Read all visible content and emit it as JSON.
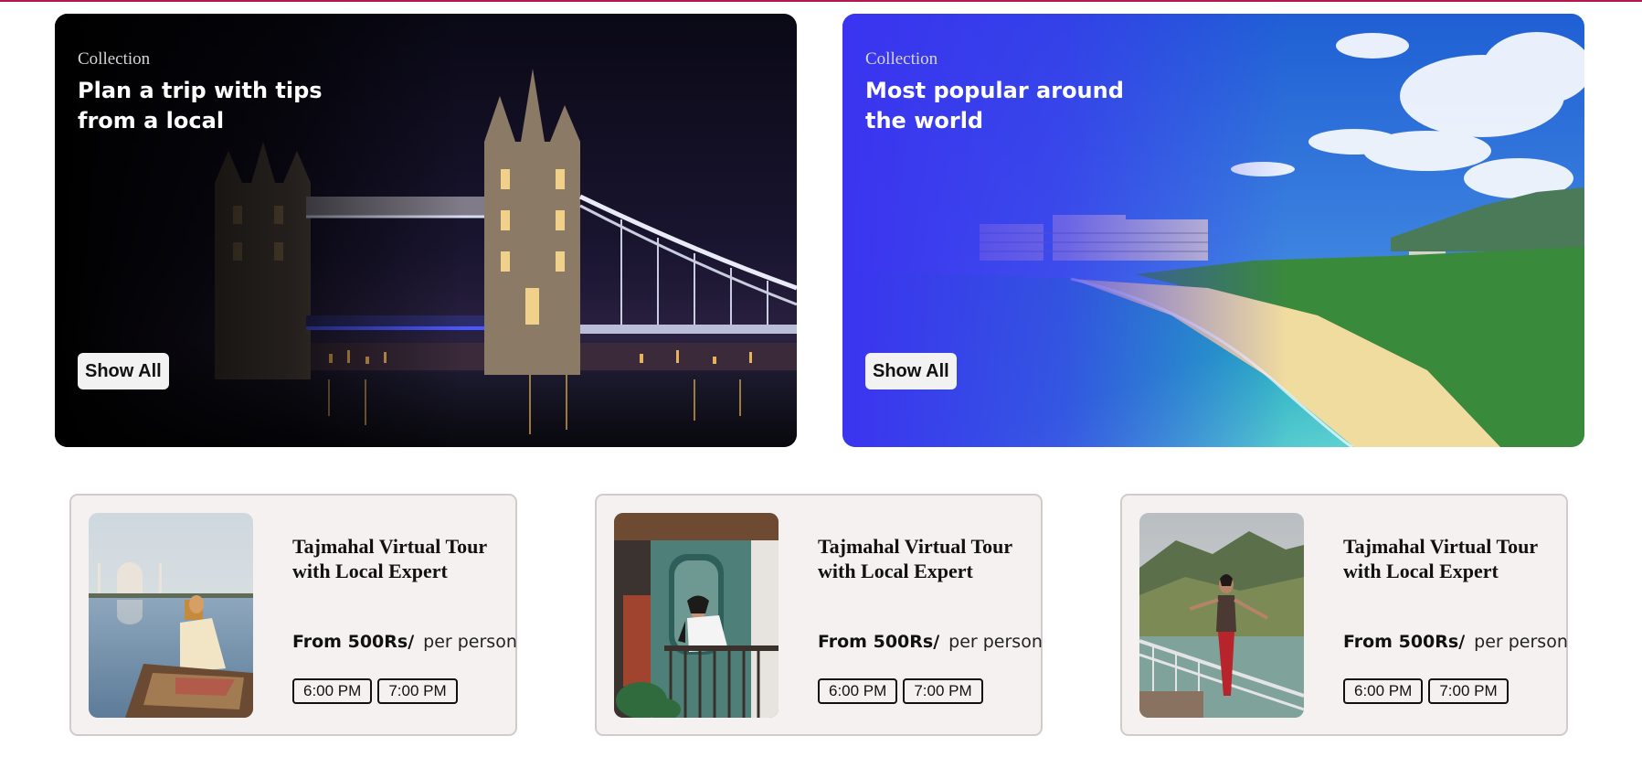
{
  "collections": [
    {
      "eyebrow": "Collection",
      "title": "Plan a trip with tips from a local",
      "button_label": "Show All",
      "image": "tower-bridge-night"
    },
    {
      "eyebrow": "Collection",
      "title": "Most popular around the world",
      "button_label": "Show All",
      "image": "tropical-beach-resort"
    }
  ],
  "tours": [
    {
      "title": "Tajmahal Virtual Tour with Local Expert",
      "price": "From 500Rs/",
      "price_unit": "per person",
      "times": [
        "6:00 PM",
        "7:00 PM"
      ],
      "image": "taj-mahal-boat-woman"
    },
    {
      "title": "Tajmahal Virtual Tour with Local Expert",
      "price": "From 500Rs/",
      "price_unit": "per person",
      "times": [
        "6:00 PM",
        "7:00 PM"
      ],
      "image": "balcony-woman"
    },
    {
      "title": "Tajmahal Virtual Tour with Local Expert",
      "price": "From 500Rs/",
      "price_unit": "per person",
      "times": [
        "6:00 PM",
        "7:00 PM"
      ],
      "image": "mountain-bridge-woman"
    }
  ],
  "colors": {
    "top_rule": "#b5174f",
    "banner_blue": "#3b34f0",
    "card_bg": "#f6f1f1",
    "card_border": "#d0cccc"
  }
}
